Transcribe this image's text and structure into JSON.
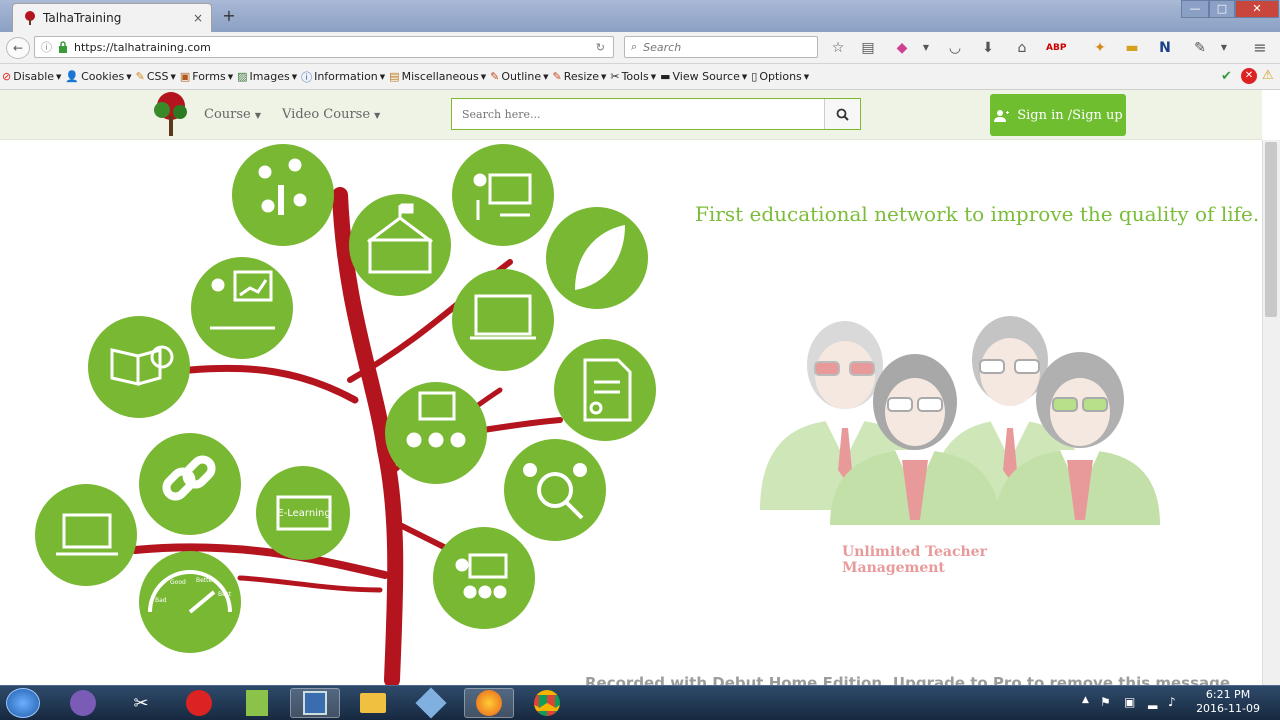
{
  "browser": {
    "tab_title": "TalhaTraining",
    "tab_close": "×",
    "new_tab": "+",
    "url": "https://talhatraining.com",
    "search_placeholder": "Search",
    "window_buttons": [
      "—",
      "□",
      "✕"
    ]
  },
  "devtoolbar": {
    "items": [
      {
        "label": "Disable",
        "icon": "disable-icon"
      },
      {
        "label": "Cookies",
        "icon": "cookies-icon"
      },
      {
        "label": "CSS",
        "icon": "css-icon"
      },
      {
        "label": "Forms",
        "icon": "forms-icon"
      },
      {
        "label": "Images",
        "icon": "images-icon"
      },
      {
        "label": "Information",
        "icon": "information-icon"
      },
      {
        "label": "Miscellaneous",
        "icon": "miscellaneous-icon"
      },
      {
        "label": "Outline",
        "icon": "outline-icon"
      },
      {
        "label": "Resize",
        "icon": "resize-icon"
      },
      {
        "label": "Tools",
        "icon": "tools-icon"
      },
      {
        "label": "View Source",
        "icon": "view-source-icon"
      },
      {
        "label": "Options",
        "icon": "options-icon"
      }
    ]
  },
  "site": {
    "nav": {
      "course": "Course",
      "video_course": "Video Course"
    },
    "search_placeholder": "Search here...",
    "signin_label": "Sign in /Sign up",
    "tagline": "First educational network to improve the quality of life.",
    "teacher_caption": "Unlimited Teacher Management",
    "elearning_label": "E-Learning",
    "gauge_labels": [
      "Bad",
      "Good",
      "Better",
      "Best"
    ]
  },
  "overlay": {
    "watermark": "Recorded with Debut Home Edition. Upgrade to Pro to remove this message"
  },
  "taskbar": {
    "time": "6:21 PM",
    "date": "2016-11-09"
  },
  "colors": {
    "brand_green": "#78b833",
    "tree_red": "#b3141d",
    "tagline_green": "#7bbd3a",
    "caption_pink": "#e89a9a"
  }
}
